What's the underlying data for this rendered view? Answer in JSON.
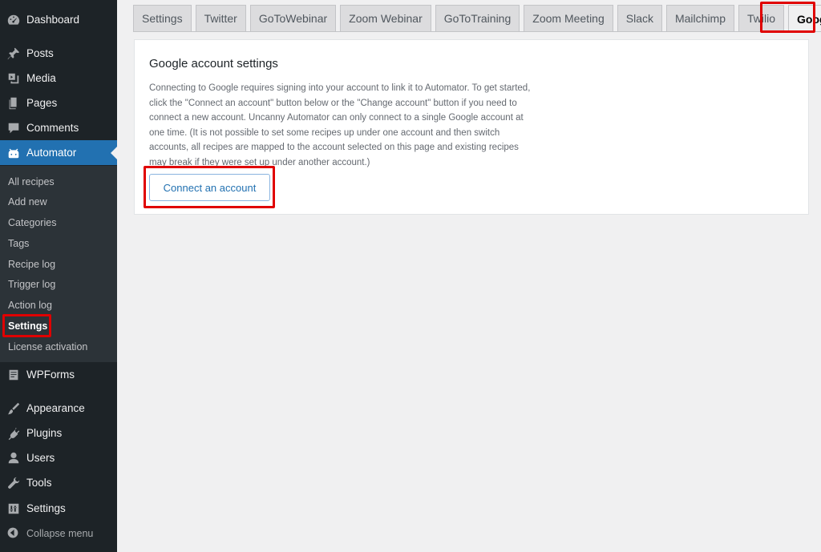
{
  "sidebar": {
    "menu": [
      {
        "label": "Dashboard",
        "icon": "dashboard-icon"
      },
      {
        "label": "Posts",
        "icon": "pin-icon"
      },
      {
        "label": "Media",
        "icon": "media-icon"
      },
      {
        "label": "Pages",
        "icon": "pages-icon"
      },
      {
        "label": "Comments",
        "icon": "comment-icon"
      },
      {
        "label": "Automator",
        "icon": "automator-robot-icon"
      },
      {
        "label": "WPForms",
        "icon": "forms-icon"
      },
      {
        "label": "Appearance",
        "icon": "brush-icon"
      },
      {
        "label": "Plugins",
        "icon": "plugin-icon"
      },
      {
        "label": "Users",
        "icon": "user-icon"
      },
      {
        "label": "Tools",
        "icon": "wrench-icon"
      },
      {
        "label": "Settings",
        "icon": "settings-icon"
      }
    ],
    "submenu": [
      "All recipes",
      "Add new",
      "Categories",
      "Tags",
      "Recipe log",
      "Trigger log",
      "Action log",
      "Settings",
      "License activation"
    ],
    "collapse_label": "Collapse menu"
  },
  "tabs": [
    "Settings",
    "Twitter",
    "GoToWebinar",
    "Zoom Webinar",
    "GoToTraining",
    "Zoom Meeting",
    "Slack",
    "Mailchimp",
    "Twilio",
    "Google"
  ],
  "active_tab": "Google",
  "card": {
    "title": "Google account settings",
    "description": "Connecting to Google requires signing into your account to link it to Automator. To get started, click the \"Connect an account\" button below or the \"Change account\" button if you need to connect a new account. Uncanny Automator can only connect to a single Google account at one time. (It is not possible to set some recipes up under one account and then switch accounts, all recipes are mapped to the account selected on this page and existing recipes may break if they were set up under another account.)",
    "button_label": "Connect an account"
  },
  "colors": {
    "sidebar_bg": "#1d2327",
    "submenu_bg": "#2c3338",
    "active_blue": "#2271b1",
    "highlight_red": "#e00000"
  }
}
